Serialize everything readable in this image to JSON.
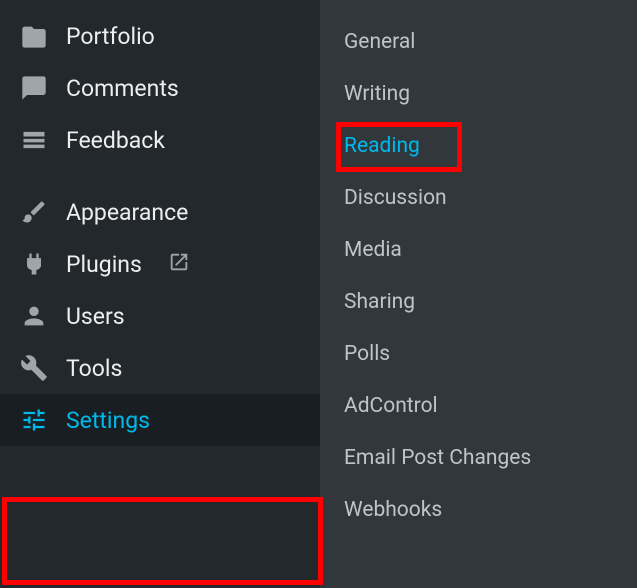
{
  "sidebar": {
    "items": [
      {
        "label": "Portfolio"
      },
      {
        "label": "Comments"
      },
      {
        "label": "Feedback"
      },
      {
        "label": "Appearance"
      },
      {
        "label": "Plugins"
      },
      {
        "label": "Users"
      },
      {
        "label": "Tools"
      },
      {
        "label": "Settings"
      }
    ]
  },
  "submenu": {
    "items": [
      {
        "label": "General"
      },
      {
        "label": "Writing"
      },
      {
        "label": "Reading"
      },
      {
        "label": "Discussion"
      },
      {
        "label": "Media"
      },
      {
        "label": "Sharing"
      },
      {
        "label": "Polls"
      },
      {
        "label": "AdControl"
      },
      {
        "label": "Email Post Changes"
      },
      {
        "label": "Webhooks"
      }
    ]
  }
}
